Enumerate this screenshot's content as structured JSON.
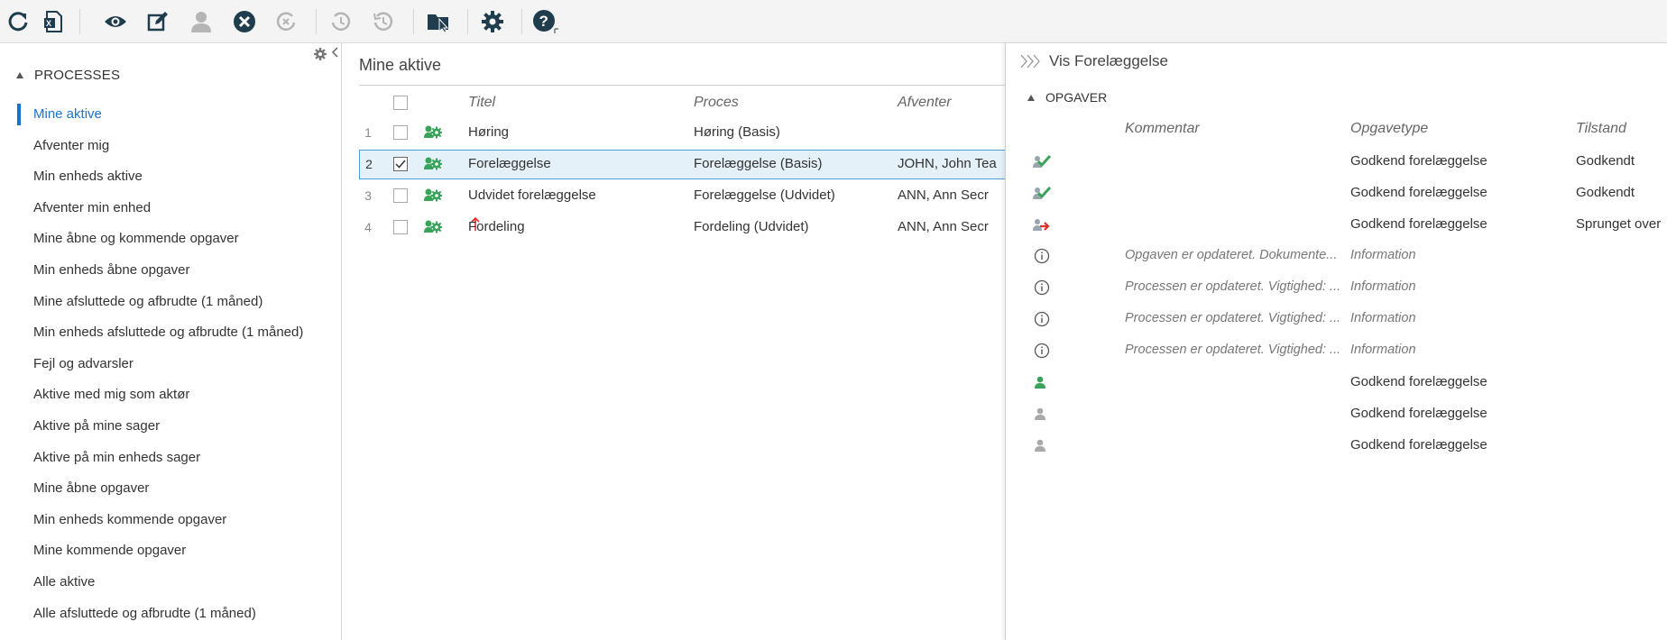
{
  "toolbar": {
    "buttons": [
      {
        "name": "refresh-icon"
      },
      {
        "name": "excel-export-icon"
      },
      {
        "name": "view-icon"
      },
      {
        "name": "edit-icon"
      },
      {
        "name": "user-icon"
      },
      {
        "name": "cancel-icon"
      },
      {
        "name": "cancel-process-icon"
      },
      {
        "name": "restore-icon"
      },
      {
        "name": "history-icon"
      },
      {
        "name": "move-folder-icon"
      },
      {
        "name": "settings-icon"
      },
      {
        "name": "help-icon"
      }
    ],
    "colors": {
      "active": "#1f3d4d",
      "disabled": "#b5b5b5"
    }
  },
  "sidebar": {
    "header": "PROCESSES",
    "items": [
      {
        "label": "Mine aktive",
        "active": true
      },
      {
        "label": "Afventer mig"
      },
      {
        "label": "Min enheds aktive"
      },
      {
        "label": "Afventer min enhed"
      },
      {
        "label": "Mine åbne og kommende opgaver"
      },
      {
        "label": "Min enheds åbne opgaver"
      },
      {
        "label": "Mine afsluttede og afbrudte (1 måned)"
      },
      {
        "label": "Min enheds afsluttede og afbrudte (1 måned)"
      },
      {
        "label": "Fejl og advarsler"
      },
      {
        "label": "Aktive med mig som aktør"
      },
      {
        "label": "Aktive på mine sager"
      },
      {
        "label": "Aktive på min enheds sager"
      },
      {
        "label": "Mine åbne opgaver"
      },
      {
        "label": "Min enheds kommende opgaver"
      },
      {
        "label": "Mine kommende opgaver"
      },
      {
        "label": "Alle aktive"
      },
      {
        "label": "Alle afsluttede og afbrudte (1 måned)"
      }
    ]
  },
  "main": {
    "title": "Mine aktive",
    "columns": {
      "titel": "Titel",
      "proces": "Proces",
      "afventer": "Afventer"
    },
    "rows": [
      {
        "num": "1",
        "titel": "Høring",
        "proces": "Høring (Basis)",
        "afventer": "",
        "checked": false,
        "priority": false
      },
      {
        "num": "2",
        "titel": "Forelæggelse",
        "proces": "Forelæggelse (Basis)",
        "afventer": "JOHN, John Tea",
        "checked": true,
        "priority": false
      },
      {
        "num": "3",
        "titel": "Udvidet forelæggelse",
        "proces": "Forelæggelse (Udvidet)",
        "afventer": "ANN, Ann Secr",
        "checked": false,
        "priority": false
      },
      {
        "num": "4",
        "titel": "Fordeling",
        "proces": "Fordeling (Udvidet)",
        "afventer": "ANN, Ann Secr",
        "checked": false,
        "priority": true
      }
    ]
  },
  "panel": {
    "title": "Vis Forelæggelse",
    "section": "OPGAVER",
    "columns": {
      "kommentar": "Kommentar",
      "opgavetype": "Opgavetype",
      "tilstand": "Tilstand"
    },
    "rows": [
      {
        "icon": "approved-check-icon",
        "kommentar": "",
        "opgavetype": "Godkend forelæggelse",
        "tilstand": "Godkendt",
        "info": false
      },
      {
        "icon": "approved-check-icon",
        "kommentar": "",
        "opgavetype": "Godkend forelæggelse",
        "tilstand": "Godkendt",
        "info": false
      },
      {
        "icon": "skipped-user-icon",
        "kommentar": "",
        "opgavetype": "Godkend forelæggelse",
        "tilstand": "Sprunget over",
        "info": false
      },
      {
        "icon": "info-icon",
        "kommentar": "Opgaven er opdateret. Dokumente...",
        "opgavetype": "Information",
        "tilstand": "",
        "info": true
      },
      {
        "icon": "info-icon",
        "kommentar": "Processen er opdateret. Vigtighed: ...",
        "opgavetype": "Information",
        "tilstand": "",
        "info": true
      },
      {
        "icon": "info-icon",
        "kommentar": "Processen er opdateret. Vigtighed: ...",
        "opgavetype": "Information",
        "tilstand": "",
        "info": true
      },
      {
        "icon": "info-icon",
        "kommentar": "Processen er opdateret. Vigtighed: ...",
        "opgavetype": "Information",
        "tilstand": "",
        "info": true
      },
      {
        "icon": "active-user-icon",
        "kommentar": "",
        "opgavetype": "Godkend forelæggelse",
        "tilstand": "",
        "info": false
      },
      {
        "icon": "pending-user-icon",
        "kommentar": "",
        "opgavetype": "Godkend forelæggelse",
        "tilstand": "",
        "info": false
      },
      {
        "icon": "pending-user-icon",
        "kommentar": "",
        "opgavetype": "Godkend forelæggelse",
        "tilstand": "",
        "info": false
      }
    ]
  }
}
